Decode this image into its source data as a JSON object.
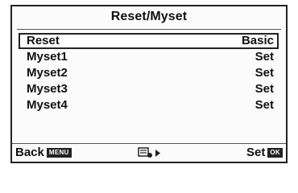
{
  "window": {
    "title": "Reset/Myset"
  },
  "menu": {
    "items": [
      {
        "label": "Reset",
        "value": "Basic",
        "selected": true
      },
      {
        "label": "Myset1",
        "value": "Set",
        "selected": false
      },
      {
        "label": "Myset2",
        "value": "Set",
        "selected": false
      },
      {
        "label": "Myset3",
        "value": "Set",
        "selected": false
      },
      {
        "label": "Myset4",
        "value": "Set",
        "selected": false
      }
    ]
  },
  "footer": {
    "back_label": "Back",
    "back_button": "MENU",
    "set_label": "Set",
    "set_button": "OK",
    "middle_icons": [
      "submenu-icon",
      "right-arrow-icon"
    ]
  }
}
